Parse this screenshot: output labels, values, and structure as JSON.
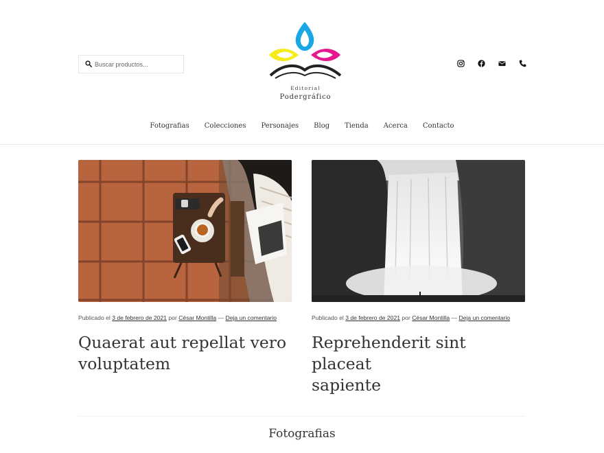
{
  "search": {
    "placeholder": "Buscar productos..."
  },
  "logo": {
    "line1": "Editorial",
    "line2": "Podergráfico"
  },
  "social": [
    "instagram-icon",
    "facebook-icon",
    "envelope-icon",
    "phone-icon"
  ],
  "nav": [
    "Fotografias",
    "Colecciones",
    "Personajes",
    "Blog",
    "Tienda",
    "Acerca",
    "Contacto"
  ],
  "posts": [
    {
      "published": "Publicado el",
      "date": "3 de febrero de 2021",
      "by": "por",
      "author": "César Montilla",
      "sep": "—",
      "comment": "Deja un comentario",
      "title_line1": "Quaerat aut repellat vero",
      "title_line2": "voluptatem"
    },
    {
      "published": "Publicado el",
      "date": "3 de febrero de 2021",
      "by": "por",
      "author": "César Montilla",
      "sep": "—",
      "comment": "Deja un comentario",
      "title_line1": "Reprehenderit sint placeat",
      "title_line2": "sapiente"
    }
  ],
  "section": {
    "title": "Fotografias"
  },
  "colors": {
    "cyan": "#1aa7e6",
    "magenta": "#e6188f",
    "yellow": "#f4ec18",
    "text": "#333333"
  }
}
